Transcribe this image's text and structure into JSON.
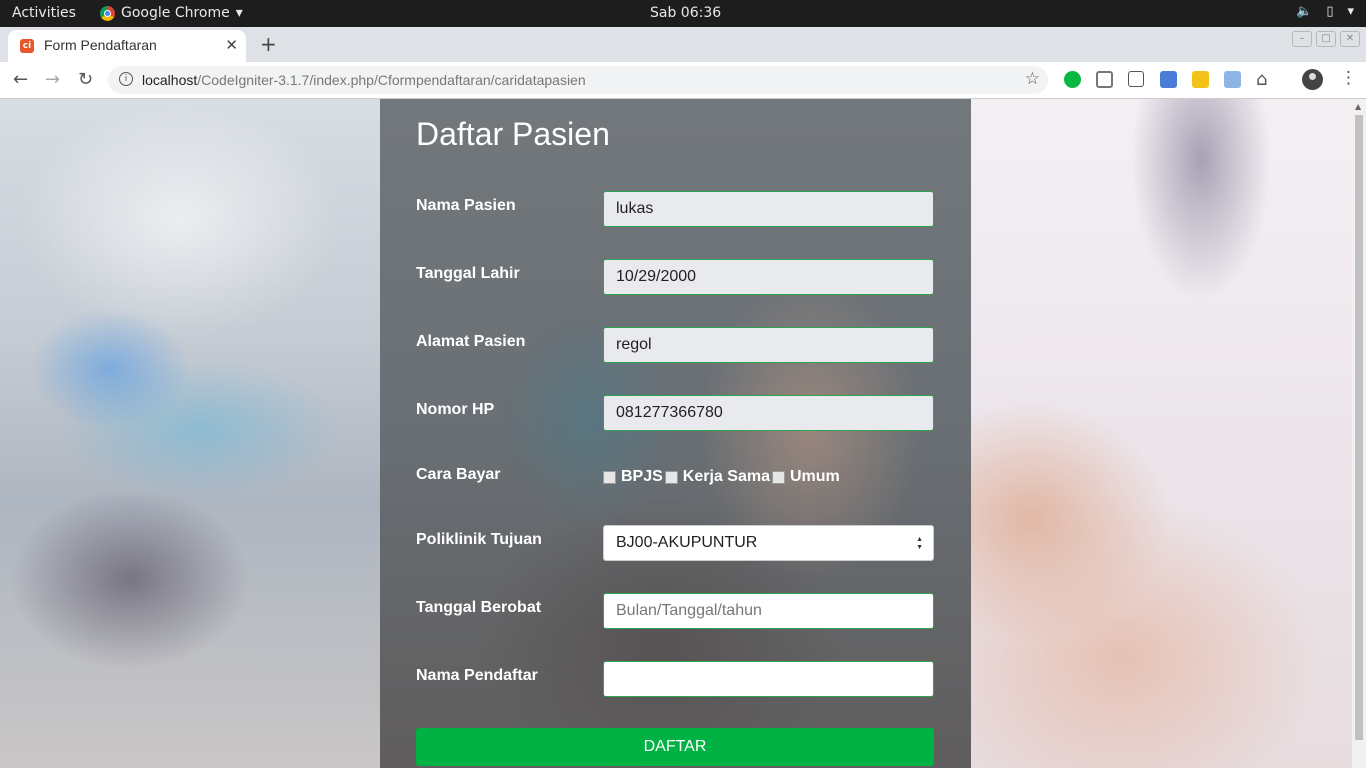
{
  "system_bar": {
    "activities": "Activities",
    "app_name": "Google Chrome",
    "clock": "Sab 06:36"
  },
  "browser": {
    "tab_title": "Form Pendaftaran",
    "url_host": "localhost",
    "url_path": "/CodeIgniter-3.1.7/index.php/Cformpendaftaran/caridatapasien"
  },
  "form": {
    "title": "Daftar Pasien",
    "fields": {
      "nama_pasien": {
        "label": "Nama Pasien",
        "value": "lukas"
      },
      "tanggal_lahir": {
        "label": "Tanggal Lahir",
        "value": "10/29/2000"
      },
      "alamat_pasien": {
        "label": "Alamat Pasien",
        "value": "regol"
      },
      "nomor_hp": {
        "label": "Nomor HP",
        "value": "081277366780"
      },
      "poliklinik": {
        "label": "Poliklinik Tujuan",
        "value": "BJ00-AKUPUNTUR"
      },
      "tanggal_berobat": {
        "label": "Tanggal Berobat",
        "placeholder": "Bulan/Tanggal/tahun"
      },
      "nama_pendaftar": {
        "label": "Nama Pendaftar",
        "value": ""
      }
    },
    "cara_bayar": {
      "label": "Cara Bayar",
      "options": [
        "BPJS",
        "Kerja Sama",
        "Umum"
      ]
    },
    "submit_label": "DAFTAR"
  },
  "colors": {
    "accent_green": "#00b243",
    "field_border": "#2ea44f"
  }
}
